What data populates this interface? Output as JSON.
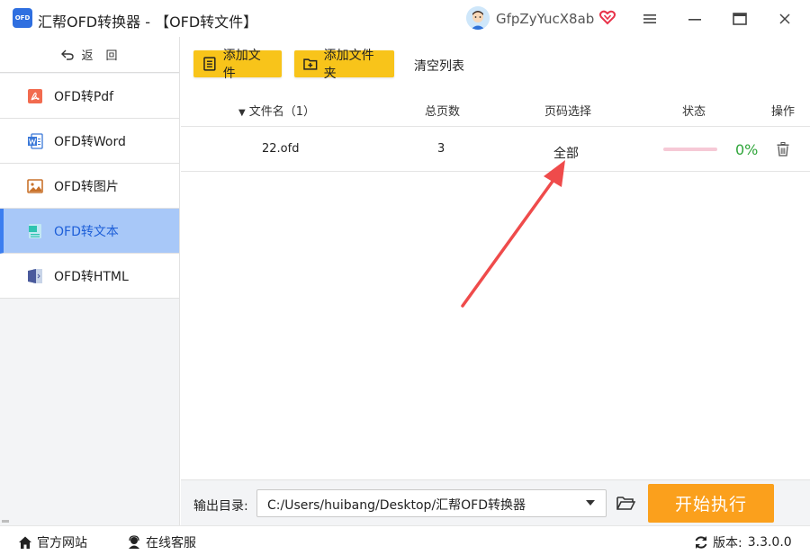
{
  "window": {
    "logo_text": "OFD",
    "title": "汇帮OFD转换器 - 【OFD转文件】",
    "username": "GfpZyYucX8ab"
  },
  "sidebar": {
    "back_label": "返回",
    "items": [
      {
        "label": "OFD转Pdf",
        "icon": "pdf-icon"
      },
      {
        "label": "OFD转Word",
        "icon": "word-icon"
      },
      {
        "label": "OFD转图片",
        "icon": "image-icon"
      },
      {
        "label": "OFD转文本",
        "icon": "text-icon",
        "active": true
      },
      {
        "label": "OFD转HTML",
        "icon": "html-icon"
      }
    ]
  },
  "toolbar": {
    "add_file": "添加文件",
    "add_folder": "添加文件夹",
    "clear_list": "清空列表"
  },
  "table": {
    "headers": {
      "name": "文件名（1）",
      "pages": "总页数",
      "range": "页码选择",
      "status": "状态",
      "ops": "操作"
    },
    "rows": [
      {
        "name": "22.ofd",
        "pages": "3",
        "range": "全部",
        "progress": 0,
        "percent": "0%"
      }
    ]
  },
  "output": {
    "label": "输出目录:",
    "path": "C:/Users/huibang/Desktop/汇帮OFD转换器",
    "start_label": "开始执行"
  },
  "statusbar": {
    "website": "官方网站",
    "support": "在线客服",
    "version_label": "版本:",
    "version_value": "3.3.0.0"
  },
  "colors": {
    "accent_blue": "#3c7ef0",
    "active_bg": "#a8c8f8",
    "toolbar_yellow": "#f8c41a",
    "start_orange": "#fba01c",
    "progress_green": "#2fa53a",
    "progress_track": "#f6c9d6",
    "arrow_red": "#ef4b4b"
  }
}
